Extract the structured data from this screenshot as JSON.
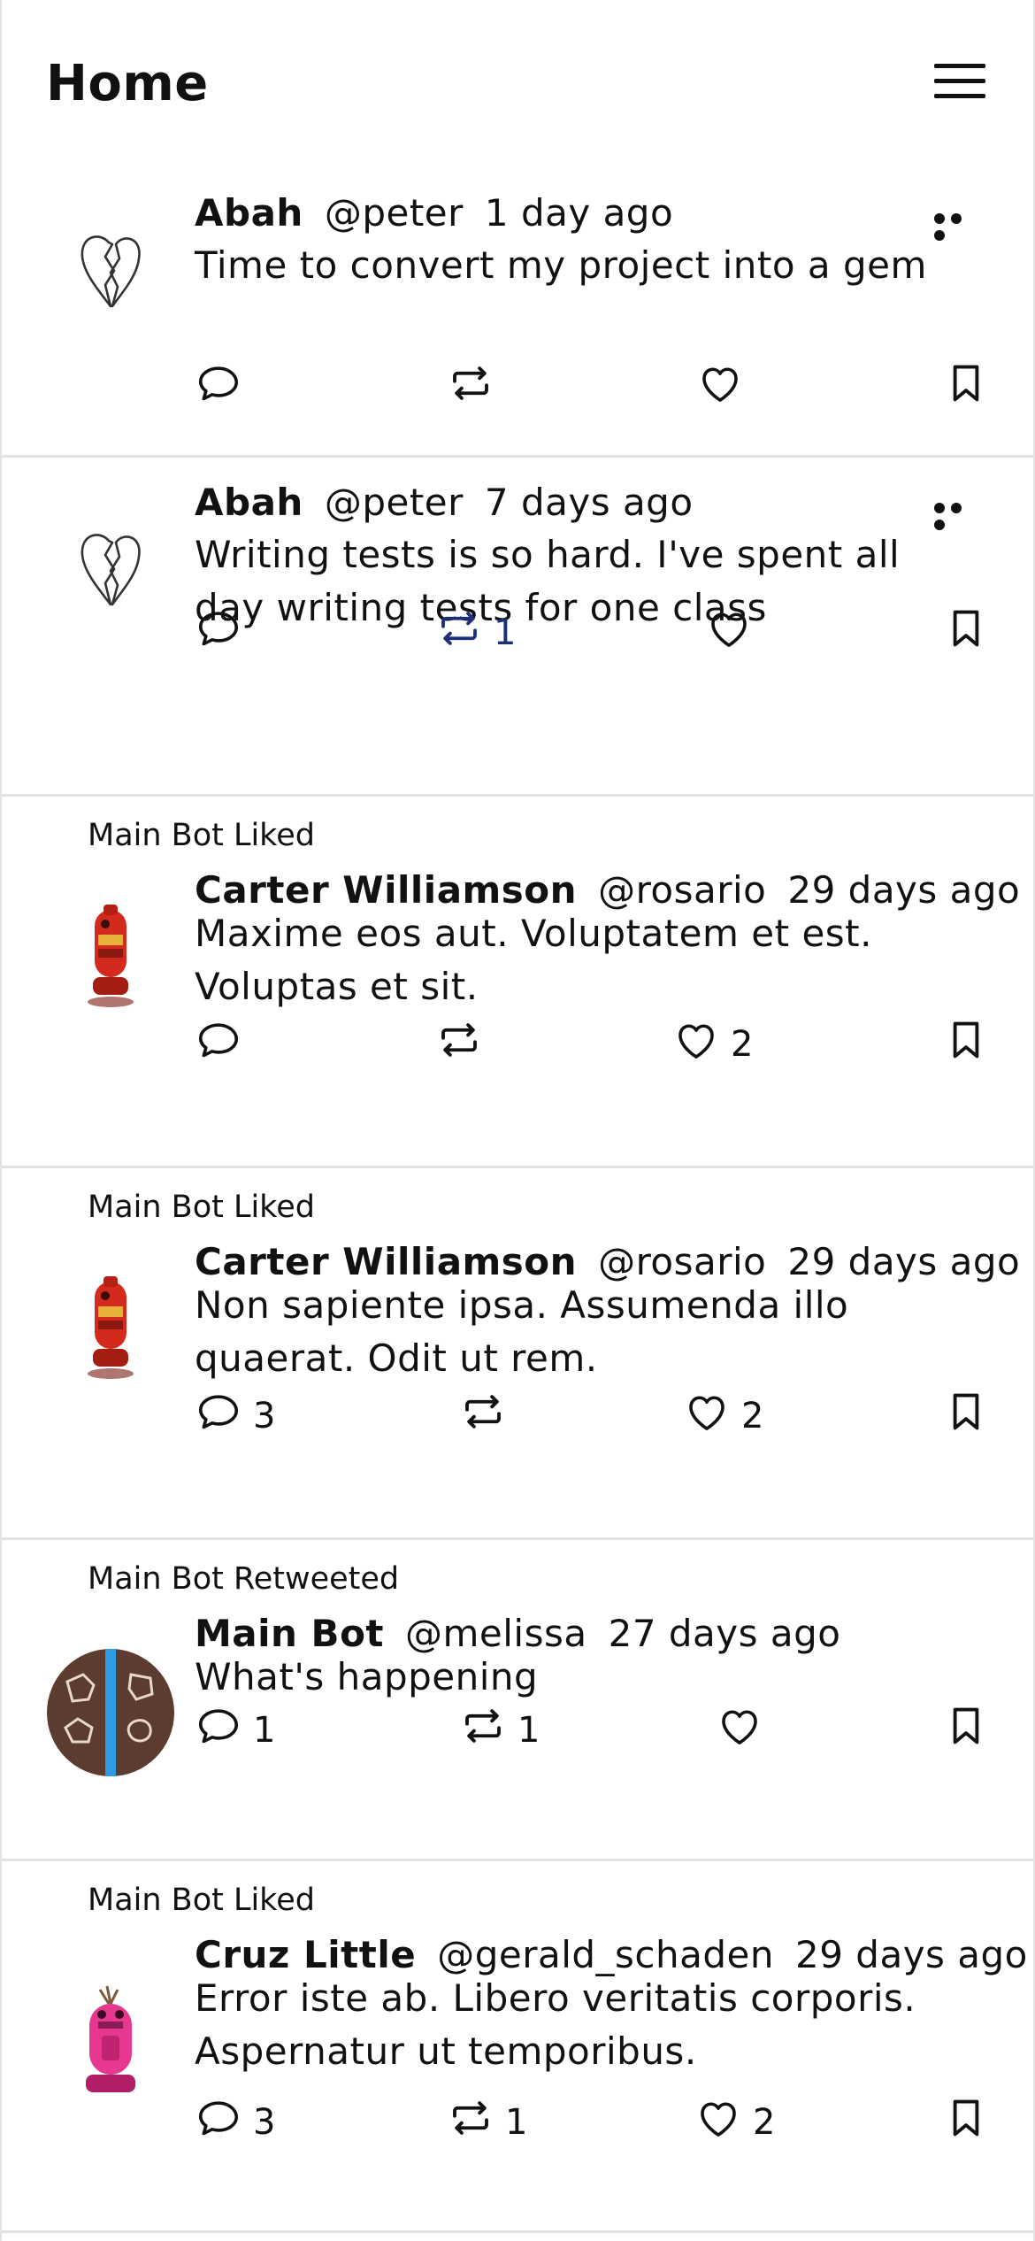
{
  "header": {
    "title": "Home",
    "menu_icon": "hamburger-menu-icon"
  },
  "tweets": [
    {
      "context": "",
      "avatar": "broken-heart",
      "name": "Abah",
      "handle": "@peter",
      "time": "1 day ago",
      "text": "Time to convert my project into a gem",
      "show_more": true,
      "comments": "",
      "retweets": "",
      "likes": "",
      "retweet_active": false
    },
    {
      "context": "",
      "avatar": "broken-heart",
      "name": "Abah",
      "handle": "@peter",
      "time": "7 days ago",
      "text": "Writing tests is so hard. I've spent all day writing tests for one class",
      "show_more": true,
      "comments": "",
      "retweets": "1",
      "likes": "",
      "retweet_active": true
    },
    {
      "context": "Main Bot Liked",
      "avatar": "red-robot",
      "name": "Carter Williamson",
      "handle": "@rosario",
      "time": "29 days ago",
      "text": "Maxime eos aut. Voluptatem et est. Voluptas et sit.",
      "show_more": false,
      "comments": "",
      "retweets": "",
      "likes": "2",
      "retweet_active": false
    },
    {
      "context": "Main Bot Liked",
      "avatar": "red-robot",
      "name": "Carter Williamson",
      "handle": "@rosario",
      "time": "29 days ago",
      "text": "Non sapiente ipsa. Assumenda illo quaerat. Odit ut rem.",
      "show_more": false,
      "comments": "3",
      "retweets": "",
      "likes": "2",
      "retweet_active": false
    },
    {
      "context": "Main Bot Retweeted",
      "avatar": "brown-circle",
      "name": "Main Bot",
      "handle": "@melissa",
      "time": "27 days ago",
      "text": "What's happening",
      "show_more": false,
      "comments": "1",
      "retweets": "1",
      "likes": "",
      "retweet_active": false
    },
    {
      "context": "Main Bot Liked",
      "avatar": "pink-robot",
      "name": "Cruz Little",
      "handle": "@gerald_schaden",
      "time": "29 days ago",
      "text": "Error iste ab. Libero veritatis corporis. Aspernatur ut temporibus.",
      "show_more": false,
      "comments": "3",
      "retweets": "1",
      "likes": "2",
      "retweet_active": false
    }
  ],
  "colors": {
    "accent": "#1e2f7a",
    "divider": "#e2e2e2",
    "text": "#111111"
  },
  "icons": {
    "comment": "comment-icon",
    "retweet": "retweet-icon",
    "like": "heart-icon",
    "bookmark": "bookmark-icon",
    "more": "more-options-icon"
  }
}
